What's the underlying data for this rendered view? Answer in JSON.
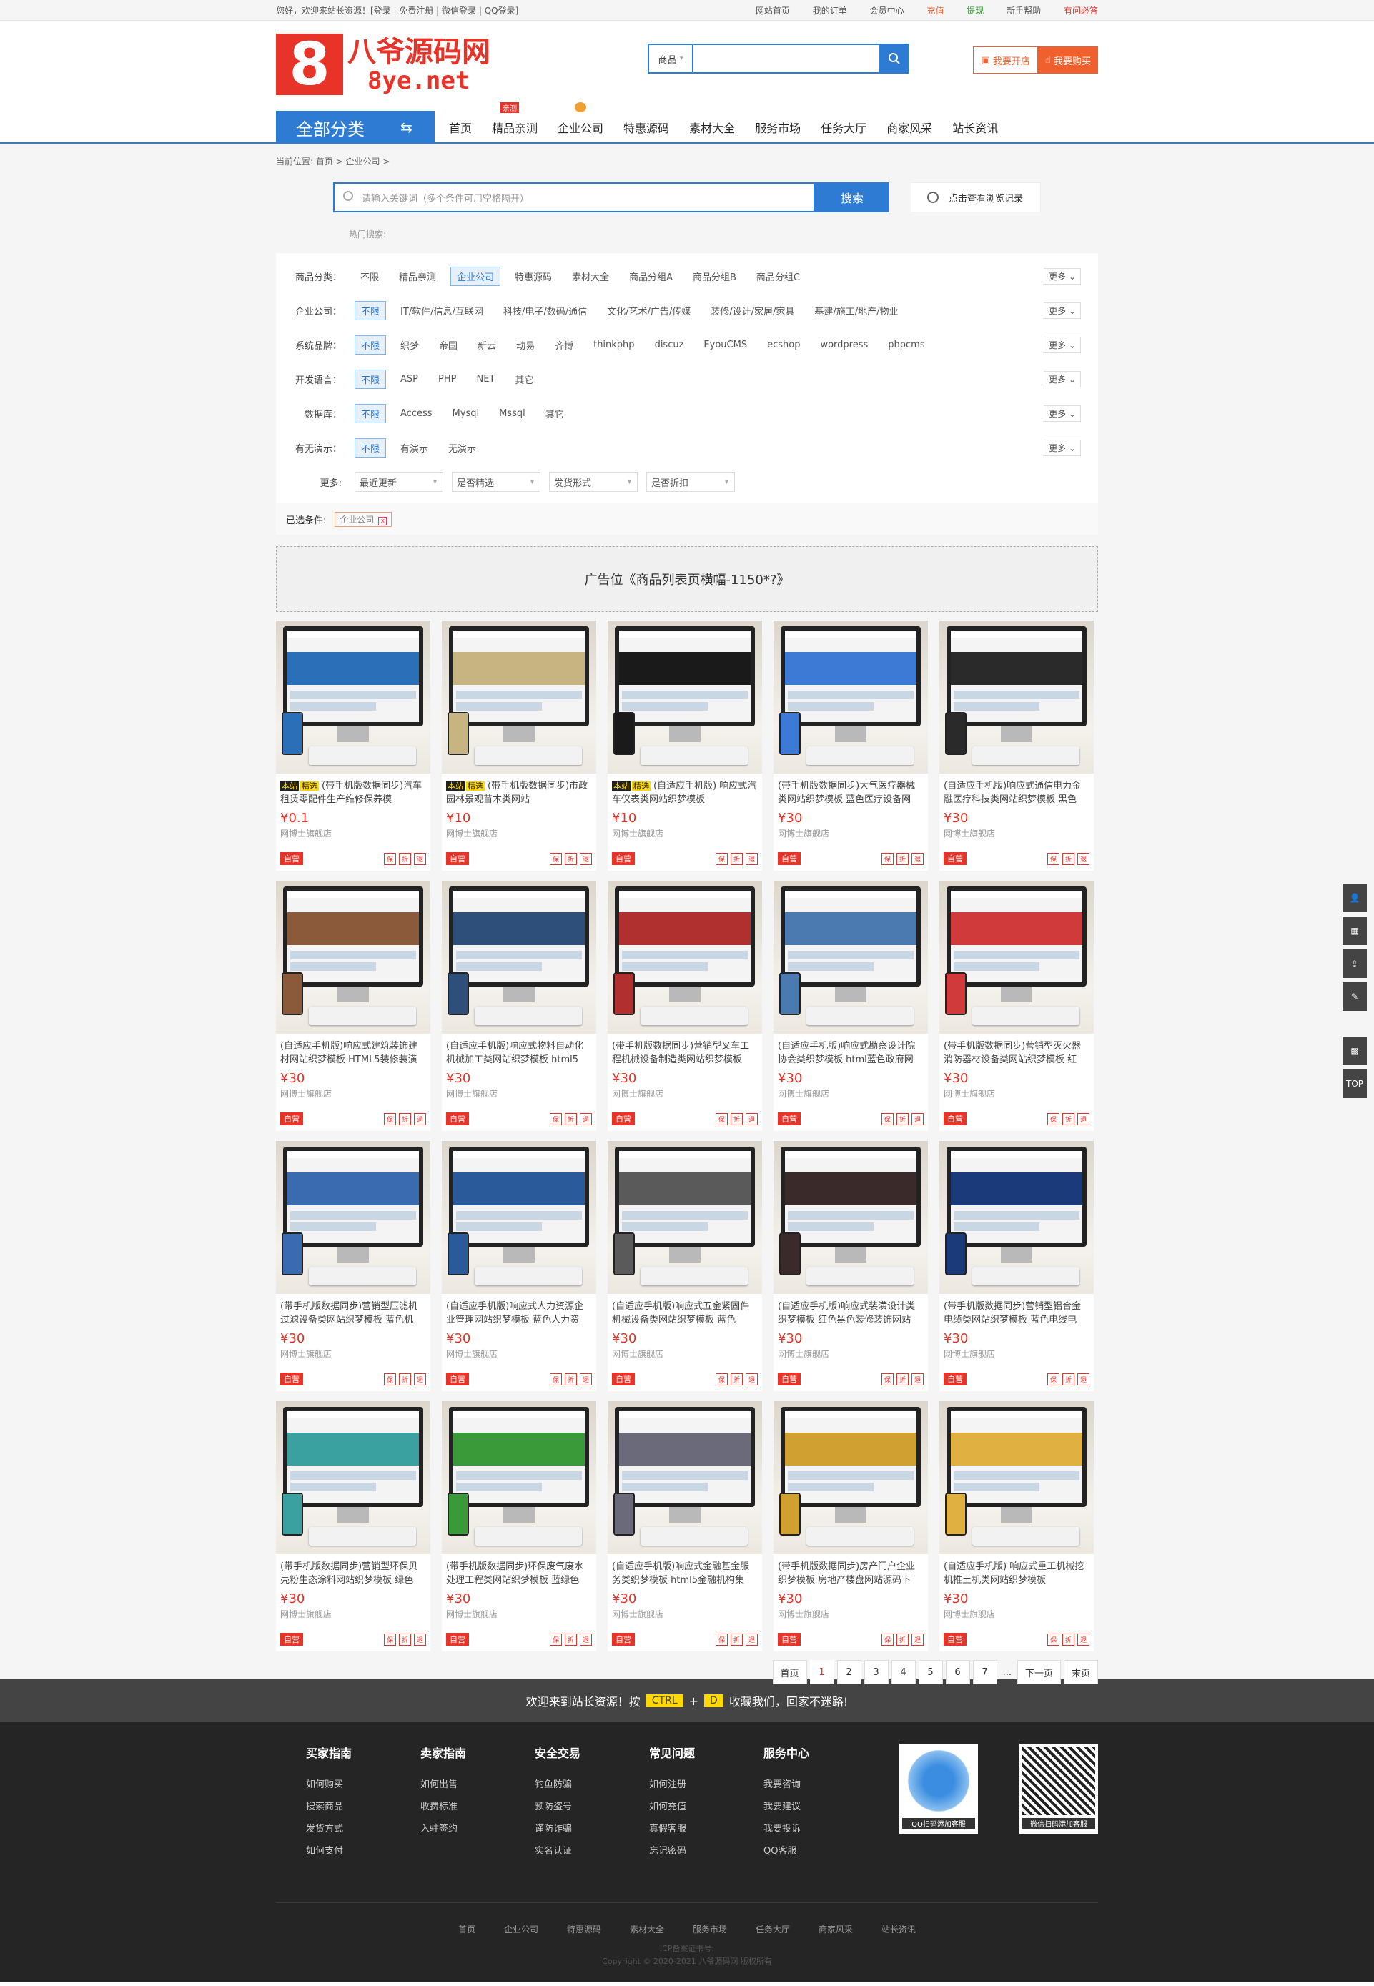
{
  "topbar": {
    "welcome": "您好，欢迎来站长资源！[登录 | 免费注册 | 微信登录 | QQ登录]",
    "links": [
      "网站首页",
      "我的订单",
      "会员中心",
      "充值",
      "提现",
      "新手帮助",
      "有问必答"
    ]
  },
  "logo": {
    "box": "8",
    "cn": "八爷源码网",
    "en": "8ye.net"
  },
  "search": {
    "category": "商品",
    "placeholder": ""
  },
  "header_buttons": {
    "open_shop": "我要开店",
    "buy": "我要购买"
  },
  "nav": {
    "all_label": "全部分类",
    "items": [
      "首页",
      "精品亲测",
      "企业公司",
      "特惠源码",
      "素材大全",
      "服务市场",
      "任务大厅",
      "商家风采",
      "站长资讯"
    ],
    "badge": "亲测"
  },
  "crumb": "当前位置: 首页 > 企业公司 >",
  "search2": {
    "placeholder": "请输入关键词（多个条件可用空格隔开）",
    "button": "搜索",
    "history": "点击查看浏览记录",
    "hot": "热门搜索:"
  },
  "filters": [
    {
      "label": "商品分类：",
      "options": [
        "不限",
        "精品亲测",
        "企业公司",
        "特惠源码",
        "素材大全",
        "商品分组A",
        "商品分组B",
        "商品分组C"
      ],
      "active": 2,
      "more": "更多"
    },
    {
      "label": "企业公司：",
      "options": [
        "不限",
        "IT/软件/信息/互联网",
        "科技/电子/数码/通信",
        "文化/艺术/广告/传媒",
        "装修/设计/家居/家具",
        "基建/施工/地产/物业"
      ],
      "active": 0,
      "more": "更多"
    },
    {
      "label": "系统品牌：",
      "options": [
        "不限",
        "织梦",
        "帝国",
        "新云",
        "动易",
        "齐博",
        "thinkphp",
        "discuz",
        "EyouCMS",
        "ecshop",
        "wordpress",
        "phpcms"
      ],
      "active": 0,
      "more": "更多"
    },
    {
      "label": "开发语言：",
      "options": [
        "不限",
        "ASP",
        "PHP",
        "NET",
        "其它"
      ],
      "active": 0,
      "more": "更多"
    },
    {
      "label": "数据库：",
      "options": [
        "不限",
        "Access",
        "Mysql",
        "Mssql",
        "其它"
      ],
      "active": 0,
      "more": "更多"
    },
    {
      "label": "有无演示：",
      "options": [
        "不限",
        "有演示",
        "无演示"
      ],
      "active": 0,
      "more": "更多"
    }
  ],
  "more_row": {
    "label": "更多:",
    "dropdowns": [
      "最近更新",
      "是否精选",
      "发货形式",
      "是否折扣"
    ]
  },
  "selected": {
    "label": "已选条件:",
    "tag": "企业公司"
  },
  "ad": "广告位《商品列表页横幅-1150*?》",
  "shop": "网博士旗舰店",
  "self_label": "自营",
  "icons": [
    "保",
    "折",
    "退"
  ],
  "products": [
    {
      "bz": "本站",
      "jx": "精选",
      "title": "(带手机版数据同步)汽车租赁零配件生产维修保养模",
      "price": "¥0.1",
      "color": "#2a6fb8"
    },
    {
      "bz": "本站",
      "jx": "精选",
      "title": "(带手机版数据同步)市政园林景观苗木类网站",
      "price": "¥10",
      "color": "#c8b480"
    },
    {
      "bz": "本站",
      "jx": "精选",
      "title": "(自适应手机版) 响应式汽车仪表类网站织梦模板",
      "price": "¥10",
      "color": "#1a1a1a"
    },
    {
      "title": "(带手机版数据同步)大气医疗器械类网站织梦模板 蓝色医疗设备网",
      "price": "¥30",
      "color": "#3d7ad6"
    },
    {
      "title": "(自适应手机版)响应式通信电力金融医疗科技类网站织梦模板 黑色",
      "price": "¥30",
      "color": "#2a2a2a"
    },
    {
      "title": "(自适应手机版)响应式建筑装饰建材网站织梦模板 HTML5装修装潢",
      "price": "¥30",
      "color": "#8a5a3a"
    },
    {
      "title": "(自适应手机版)响应式物料自动化机械加工类网站织梦模板 html5",
      "price": "¥30",
      "color": "#2d4f7a"
    },
    {
      "title": "(带手机版数据同步)营销型叉车工程机械设备制造类网站织梦模板",
      "price": "¥30",
      "color": "#b03030"
    },
    {
      "title": "(自适应手机版)响应式勘察设计院协会类织梦模板 html蓝色政府网",
      "price": "¥30",
      "color": "#4a7ab0"
    },
    {
      "title": "(带手机版数据同步)营销型灭火器消防器材设备类网站织梦模板 红",
      "price": "¥30",
      "color": "#d03a3a"
    },
    {
      "title": "(带手机版数据同步)营销型压滤机过滤设备类网站织梦模板 蓝色机",
      "price": "¥30",
      "color": "#3a6ab0"
    },
    {
      "title": "(自适应手机版)响应式人力资源企业管理网站织梦模板 蓝色人力资",
      "price": "¥30",
      "color": "#2a5a9a"
    },
    {
      "title": "(自适应手机版)响应式五金紧固件机械设备类网站织梦模板 蓝色",
      "price": "¥30",
      "color": "#5a5a5a"
    },
    {
      "title": "(自适应手机版)响应式装潢设计类织梦模板 红色黑色装修装饰网站",
      "price": "¥30",
      "color": "#3a2a2a"
    },
    {
      "title": "(带手机版数据同步)营销型铝合金电缆类网站织梦模板 蓝色电线电",
      "price": "¥30",
      "color": "#1a3a7a"
    },
    {
      "title": "(带手机版数据同步)营销型环保贝壳粉生态涂料网站织梦模板 绿色",
      "price": "¥30",
      "color": "#3aa0a0"
    },
    {
      "title": "(带手机版数据同步)环保废气废水处理工程类网站织梦模板 蓝绿色",
      "price": "¥30",
      "color": "#3a9a3a"
    },
    {
      "title": "(自适应手机版)响应式金融基金服务类织梦模板 html5金融机构集",
      "price": "¥30",
      "color": "#6a6a7a"
    },
    {
      "title": "(带手机版数据同步)房产门户企业织梦模板 房地产楼盘网站源码下",
      "price": "¥30",
      "color": "#d0a030"
    },
    {
      "title": "(自适应手机版) 响应式重工机械挖机推土机类网站织梦模板",
      "price": "¥30",
      "color": "#e0b040"
    }
  ],
  "pager": {
    "first": "首页",
    "pages": [
      "1",
      "2",
      "3",
      "4",
      "5",
      "6",
      "7"
    ],
    "dots": "...",
    "next": "下一页",
    "last": "末页",
    "current": "1"
  },
  "bottombar": {
    "pre": "欢迎来到站长资源！按",
    "k1": "CTRL",
    "plus": "+",
    "k2": "D",
    "post": "收藏我们，回家不迷路!"
  },
  "footer": {
    "cols": [
      {
        "title": "买家指南",
        "items": [
          "如何购买",
          "搜索商品",
          "发货方式",
          "如何支付"
        ]
      },
      {
        "title": "卖家指南",
        "items": [
          "如何出售",
          "收费标准",
          "入驻签约"
        ]
      },
      {
        "title": "安全交易",
        "items": [
          "钓鱼防骗",
          "预防盗号",
          "谨防诈骗",
          "实名认证"
        ]
      },
      {
        "title": "常见问题",
        "items": [
          "如何注册",
          "如何充值",
          "真假客服",
          "忘记密码"
        ]
      },
      {
        "title": "服务中心",
        "items": [
          "我要咨询",
          "我要建议",
          "我要投诉",
          "QQ客服"
        ]
      }
    ],
    "qr_qq": "QQ扫码添加客服",
    "qr_wx": "微信扫码添加客服",
    "links": [
      "首页",
      "企业公司",
      "特惠源码",
      "素材大全",
      "服务市场",
      "任务大厅",
      "商家风采",
      "站长资讯"
    ],
    "icp": "ICP备案证书号:",
    "copy": "Copyright © 2020-2021 八爷源码网 版权所有"
  },
  "side": {
    "top": "TOP"
  }
}
